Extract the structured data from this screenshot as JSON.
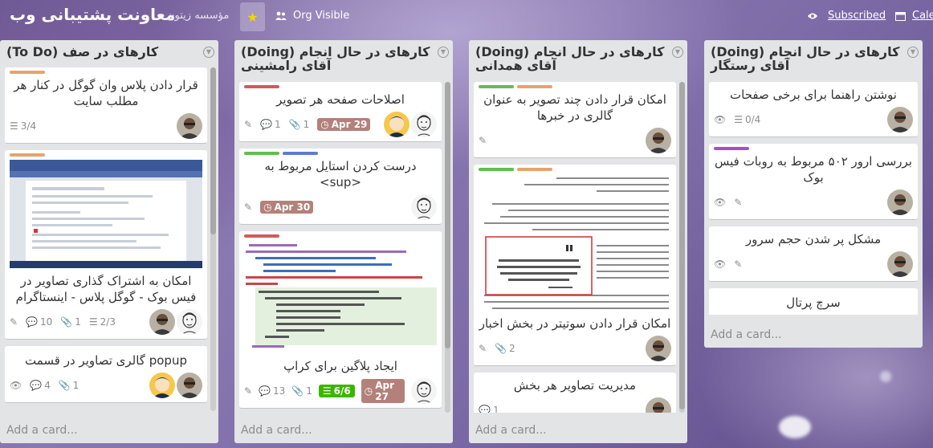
{
  "header": {
    "board_title": "معاونت پشتیبانی وب",
    "org_name": "مؤسسه زیتون",
    "visibility_label": "Org Visible",
    "subscribed_label": "Subscribed",
    "calendar_label": "Cale"
  },
  "colors": {
    "green": "#61bd4f",
    "orange": "#e6a36c",
    "red": "#d05b5b",
    "blue": "#5b7ccf",
    "purple": "#a74ccf"
  },
  "lists": [
    {
      "title": "کارهای در صف (To Do)",
      "add_card": "Add a card...",
      "cards": [
        {
          "title": "قرار دادن پلاس وان گوگل در کنار هر مطلب سایت",
          "checklist": "3/4"
        },
        {
          "title": "امکان به اشتراک گذاری تصاویر در فیس بوک - گوگل پلاس - اینستاگرام",
          "comments": "10",
          "attachments": "1",
          "checklist": "2/3"
        },
        {
          "title": "popup گالری تصاویر در قسمت",
          "comments": "4",
          "attachments": "1"
        }
      ]
    },
    {
      "title": "کارهای در حال انجام (Doing) آقای رامشینی",
      "add_card": "Add a card...",
      "cards": [
        {
          "title": "اصلاحات صفحه هر تصویر",
          "comments": "1",
          "attachments": "1",
          "due": "Apr 29"
        },
        {
          "title": "درست کردن استایل مربوط به <sup>",
          "due": "Apr 30"
        },
        {
          "title": "ایجاد پلاگین برای کراپ",
          "comments": "13",
          "attachments": "1",
          "checklist": "6/6",
          "due": "Apr 27"
        }
      ]
    },
    {
      "title": "کارهای در حال انجام (Doing) آقای همدانی",
      "add_card": "Add a card...",
      "cards": [
        {
          "title": "امکان قرار دادن چند تصویر به عنوان گالری در خبرها"
        },
        {
          "title": "امکان قرار دادن سوتیتر در بخش اخبار",
          "attachments": "2"
        },
        {
          "title": "مدیریت تصاویر هر بخش",
          "comments": "1"
        }
      ]
    },
    {
      "title": "کارهای در حال انجام (Doing) آقای رستگار",
      "add_card": "Add a card...",
      "cards": [
        {
          "title": "نوشتن راهنما برای برخی صفحات",
          "checklist": "0/4"
        },
        {
          "title": "بررسی ارور ۵۰۲ مربوط به روبات فیس بوک"
        },
        {
          "title": "مشکل پر شدن حجم سرور"
        },
        {
          "title": "سرچ پرتال"
        }
      ]
    }
  ]
}
